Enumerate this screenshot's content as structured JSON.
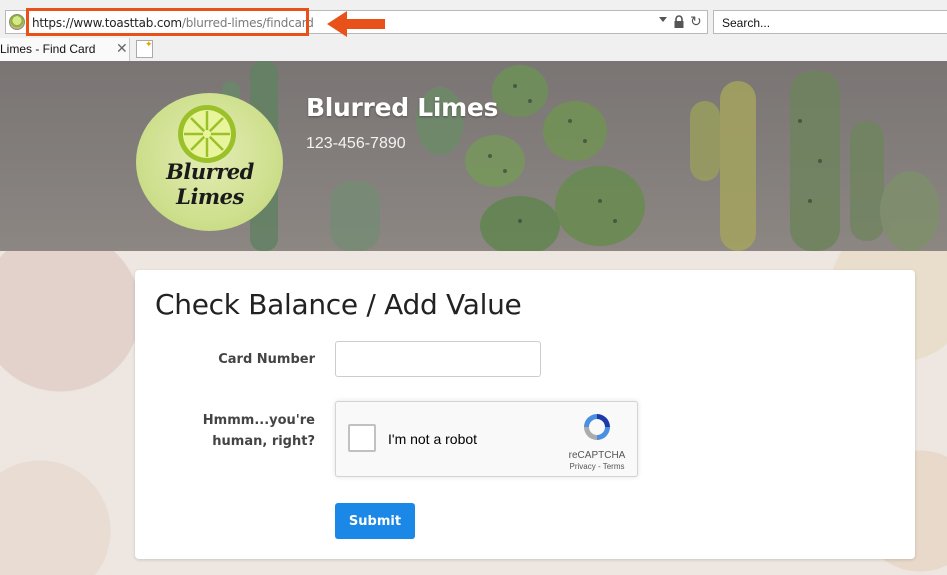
{
  "browser": {
    "url_protocol": "https://www.",
    "url_domain": "toasttab.com",
    "url_path": "/blurred-limes/findcard",
    "search_placeholder": "Search...",
    "tab_title": "Limes - Find Card",
    "tab_close": "✕",
    "annotation_color": "#e8521a"
  },
  "restaurant": {
    "name": "Blurred Limes",
    "phone": "123-456-7890",
    "logo_text": "Blurred Limes"
  },
  "form": {
    "title": "Check Balance / Add Value",
    "card_number_label": "Card Number",
    "card_number_value": "",
    "human_label": "Hmmm...you're human, right?",
    "submit_label": "Submit",
    "submit_color": "#1b87e6"
  },
  "recaptcha": {
    "label": "I'm not a robot",
    "brand": "reCAPTCHA",
    "links": "Privacy - Terms",
    "checked": false
  }
}
